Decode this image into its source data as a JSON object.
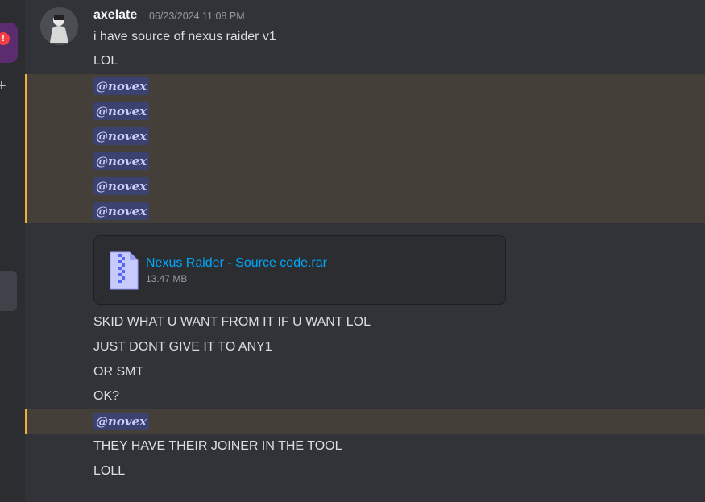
{
  "sidebar": {
    "badge": "!",
    "add_icon": "+"
  },
  "message": {
    "username": "axelate",
    "timestamp": "06/23/2024 11:08 PM",
    "lines_top": [
      "i have source of nexus raider v1",
      "LOL"
    ],
    "mention_text": "@novex",
    "mention_count_block": 6,
    "attachment": {
      "filename": "Nexus Raider - Source code.rar",
      "size": "13.47 MB",
      "icon": "zip-file-icon"
    },
    "lines_mid": [
      "SKID WHAT U WANT FROM IT IF U WANT LOL",
      "JUST DONT GIVE IT TO ANY1",
      "OR SMT",
      "OK?"
    ],
    "lines_bottom": [
      "THEY HAVE THEIR JOINER IN THE TOOL",
      "LOLL"
    ]
  },
  "colors": {
    "background": "#313338",
    "mention_highlight": "#443f39",
    "mention_bar": "#f0b232",
    "link": "#00a8fc"
  }
}
